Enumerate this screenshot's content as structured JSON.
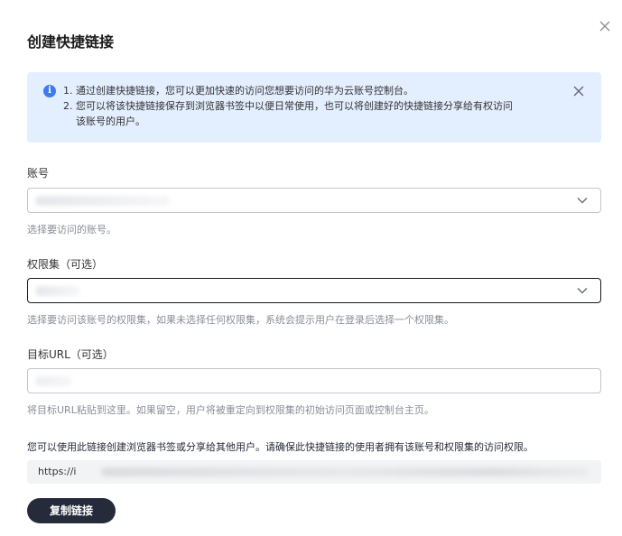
{
  "dialog": {
    "title": "创建快捷链接"
  },
  "info": {
    "line1": "1. 通过创建快捷链接，您可以更加快速的访问您想要访问的华为云账号控制台。",
    "line2": "2. 您可以将该快捷链接保存到浏览器书签中以便日常使用，也可以将创建好的快捷链接分享给有权访问",
    "line3": "该账号的用户。",
    "icon": "info-icon"
  },
  "account": {
    "label": "账号",
    "hint": "选择要访问的账号。"
  },
  "permission_set": {
    "label": "权限集（可选）",
    "hint": "选择要访问该账号的权限集，如果未选择任何权限集，系统会提示用户在登录后选择一个权限集。"
  },
  "target_url": {
    "label": "目标URL（可选）",
    "hint": "将目标URL粘贴到这里。如果留空，用户将被重定向到权限集的初始访问页面或控制台主页。"
  },
  "link": {
    "notice": "您可以使用此链接创建浏览器书签或分享给其他用户。请确保此快捷链接的使用者拥有该账号和权限集的访问权限。",
    "url_prefix": "https://i"
  },
  "buttons": {
    "copy_label": "复制链接"
  },
  "colors": {
    "info_bg": "#e3efff",
    "info_icon": "#3c7cf0",
    "primary_button": "#252b3a"
  }
}
